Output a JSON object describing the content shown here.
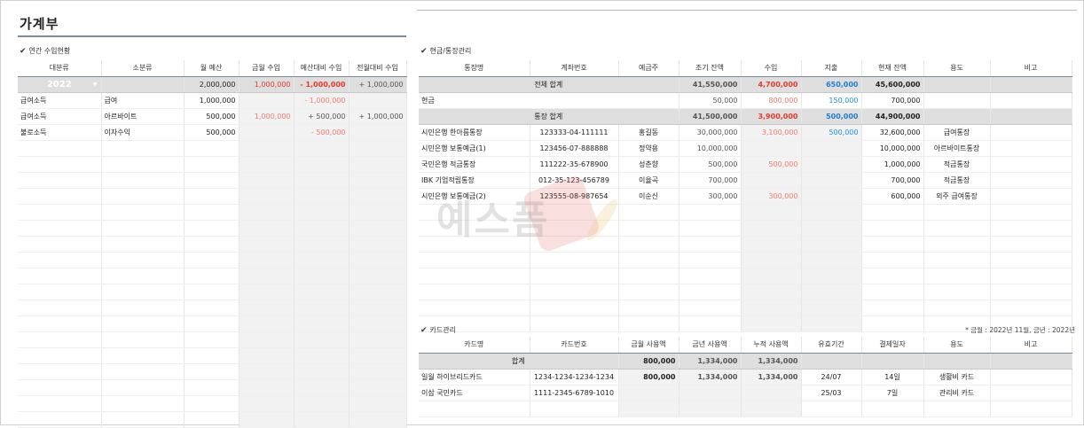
{
  "title": "가계부",
  "annual": {
    "section_title": "연간 수입현황",
    "headers": [
      "대분류",
      "소분류",
      "월 예산",
      "금월 수입",
      "예산대비 수입",
      "전월대비 수입"
    ],
    "year": "2022",
    "summary": {
      "budget": "2,000,000",
      "this_month": "1,000,000",
      "vs_budget": "- 1,000,000",
      "vs_prev": "+ 1,000,000"
    },
    "rows": [
      {
        "major": "급여소득",
        "minor": "급여",
        "budget": "1,000,000",
        "this_month": "",
        "vs_budget": "- 1,000,000",
        "vs_prev": ""
      },
      {
        "major": "급여소득",
        "minor": "아르바이트",
        "budget": "500,000",
        "this_month": "1,000,000",
        "vs_budget": "+ 500,000",
        "vs_prev": "+ 1,000,000"
      },
      {
        "major": "불로소득",
        "minor": "이자수익",
        "budget": "500,000",
        "this_month": "",
        "vs_budget": "- 500,000",
        "vs_prev": ""
      }
    ]
  },
  "cash": {
    "section_title": "현금/통장관리",
    "headers": [
      "통장명",
      "계좌번호",
      "예금주",
      "조기 잔액",
      "수입",
      "지출",
      "현재 잔액",
      "용도",
      "비고"
    ],
    "total": {
      "label": "전체 합계",
      "initial": "41,550,000",
      "income": "4,700,000",
      "expense": "650,000",
      "current": "45,600,000"
    },
    "cash_row": {
      "label": "현금",
      "initial": "50,000",
      "income": "800,000",
      "expense": "150,000",
      "current": "700,000"
    },
    "bank_total": {
      "label": "통장 합계",
      "initial": "41,500,000",
      "income": "3,900,000",
      "expense": "500,000",
      "current": "44,900,000"
    },
    "rows": [
      {
        "name": "시민은행 한아름통장",
        "account": "123333-04-111111",
        "owner": "홍길동",
        "initial": "30,000,000",
        "income": "3,100,000",
        "expense": "500,000",
        "current": "32,600,000",
        "purpose": "급여통장"
      },
      {
        "name": "시민은행 보통예금(1)",
        "account": "123456-07-888888",
        "owner": "정약용",
        "initial": "10,000,000",
        "income": "",
        "expense": "",
        "current": "10,000,000",
        "purpose": "아르바이트통장"
      },
      {
        "name": "국민은행 적금통장",
        "account": "111222-35-678900",
        "owner": "성춘향",
        "initial": "500,000",
        "income": "500,000",
        "expense": "",
        "current": "1,000,000",
        "purpose": "적금통장"
      },
      {
        "name": "IBK 기업적립통장",
        "account": "012-35-123-456789",
        "owner": "이율곡",
        "initial": "700,000",
        "income": "",
        "expense": "",
        "current": "700,000",
        "purpose": "적금통장"
      },
      {
        "name": "시민은행 보통예금(2)",
        "account": "123555-08-987654",
        "owner": "이순신",
        "initial": "300,000",
        "income": "300,000",
        "expense": "",
        "current": "600,000",
        "purpose": "외주 급여통장"
      }
    ]
  },
  "card": {
    "section_title": "카드관리",
    "note": "* 금월 : 2022년 11월, 금년 : 2022년",
    "headers": [
      "카드명",
      "카드번호",
      "금월 사용액",
      "금년 사용액",
      "누적 사용액",
      "유효기간",
      "결제일자",
      "용도",
      "비고"
    ],
    "total": {
      "label": "합계",
      "month": "800,000",
      "year": "1,334,000",
      "cumulative": "1,334,000"
    },
    "rows": [
      {
        "name": "일월 하이브리드카드",
        "number": "1234-1234-1234-1234",
        "month": "800,000",
        "year": "1,334,000",
        "cumulative": "1,334,000",
        "expiry": "24/07",
        "pay_day": "14일",
        "purpose": "생활비 카드"
      },
      {
        "name": "이삼 국민카드",
        "number": "1111-2345-6789-1010",
        "month": "",
        "year": "",
        "cumulative": "",
        "expiry": "25/03",
        "pay_day": "7일",
        "purpose": "관리비 카드"
      }
    ]
  },
  "watermark": "예스폼"
}
